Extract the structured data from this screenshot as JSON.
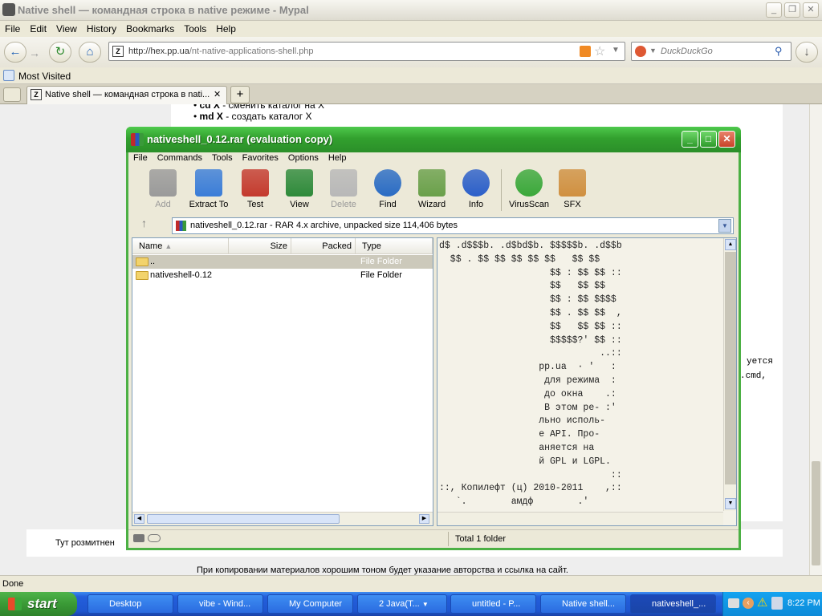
{
  "browser": {
    "title": "Native shell — командная строка в native режиме - Mypal",
    "menu": [
      "File",
      "Edit",
      "View",
      "History",
      "Bookmarks",
      "Tools",
      "Help"
    ],
    "url_domain": "http://hex.pp.ua",
    "url_path": "/nt-native-applications-shell.php",
    "search_placeholder": "DuckDuckGo",
    "bookmark": "Most Visited",
    "tab_title": "Native shell — командная строка в nati...",
    "tab_close": "✕",
    "tab_new": "+",
    "status": "Done"
  },
  "page": {
    "list_item1_bold": "cd X",
    "list_item1_rest": " - сменить каталог на X",
    "list_item2_bold": "md X",
    "list_item2_rest": " - создать каталог X",
    "right_text1": "уется",
    "right_text2": ".cmd,",
    "footer_left": "Тут розмитнен",
    "footer_copy": "При копировании материалов хорошим тоном будет указание авторства и ссылка на сайт."
  },
  "rar": {
    "title": "nativeshell_0.12.rar (evaluation copy)",
    "menu": [
      "File",
      "Commands",
      "Tools",
      "Favorites",
      "Options",
      "Help"
    ],
    "tools": [
      {
        "label": "Add",
        "color": "#9a9a9a",
        "disabled": true
      },
      {
        "label": "Extract To",
        "color": "#3a7dd8",
        "disabled": false
      },
      {
        "label": "Test",
        "color": "#c43a2e",
        "disabled": false
      },
      {
        "label": "View",
        "color": "#2e8a3a",
        "disabled": false
      },
      {
        "label": "Delete",
        "color": "#b8b8b8",
        "disabled": true
      },
      {
        "label": "Find",
        "color": "#2a6cc4",
        "disabled": false
      },
      {
        "label": "Wizard",
        "color": "#6aa04a",
        "disabled": false
      },
      {
        "label": "Info",
        "color": "#2b5fc9",
        "disabled": false
      },
      {
        "label": "VirusScan",
        "color": "#3aa83a",
        "disabled": false
      },
      {
        "label": "SFX",
        "color": "#d09040",
        "disabled": false
      }
    ],
    "address": "nativeshell_0.12.rar - RAR 4.x archive, unpacked size 114,406 bytes",
    "columns": [
      "Name",
      "Size",
      "Packed",
      "Type"
    ],
    "rows": [
      {
        "name": "..",
        "type": "File Folder"
      },
      {
        "name": "nativeshell-0.12",
        "type": "File Folder"
      }
    ],
    "comment": "d$ .d$$$b. .d$bd$b. $$$$$b. .d$$b\n  $$ . $$ $$ $$ $$ $$   $$ $$\n                    $$ : $$ $$ ::\n                    $$   $$ $$\n                    $$ : $$ $$$$\n                    $$ . $$ $$  ,\n                    $$   $$ $$ ::\n                    $$$$$?' $$ ::\n                             ..::\n                  pp.ua  · '   :\n                   для режима  :\n                   до окна    .:\n                   В этом ре- :'\n                  льно исполь-\n                  е API. Про-\n                  аняется на\n                  й GPL и LGPL.\n                               ::\n::, Копилефт (ц) 2010-2011    ,::\n   `.        амдф        .'",
    "status": "Total 1 folder"
  },
  "taskbar": {
    "start": "start",
    "items": [
      "Desktop",
      "vibe - Wind...",
      "My Computer",
      "2 Java(T...",
      "untitled - P...",
      "Native shell...",
      "nativeshell_..."
    ],
    "clock": "8:22 PM"
  }
}
